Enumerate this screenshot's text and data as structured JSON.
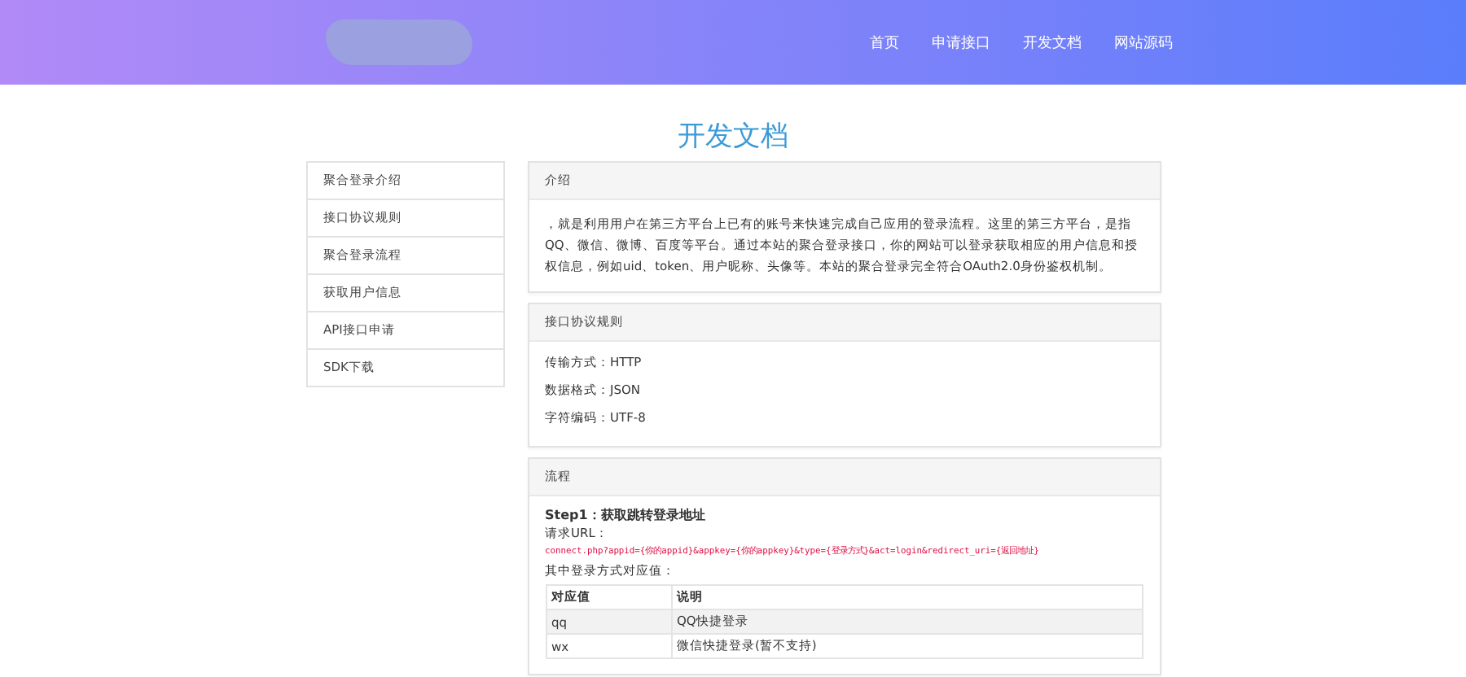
{
  "nav": [
    {
      "label": "首页"
    },
    {
      "label": "申请接口"
    },
    {
      "label": "开发文档"
    },
    {
      "label": "网站源码"
    }
  ],
  "page_title": "开发文档",
  "sidebar": {
    "items": [
      {
        "label": "聚合登录介绍"
      },
      {
        "label": "接口协议规则"
      },
      {
        "label": "聚合登录流程"
      },
      {
        "label": "获取用户信息"
      },
      {
        "label": "API接口申请"
      },
      {
        "label": "SDK下载"
      }
    ]
  },
  "intro": {
    "title": "介绍",
    "text": "，就是利用用户在第三方平台上已有的账号来快速完成自己应用的登录流程。这里的第三方平台，是指QQ、微信、微博、百度等平台。通过本站的聚合登录接口，你的网站可以登录获取相应的用户信息和授权信息，例如uid、token、用户昵称、头像等。本站的聚合登录完全符合OAuth2.0身份鉴权机制。"
  },
  "rules": {
    "title": "接口协议规则",
    "lines": [
      "传输方式：HTTP",
      "数据格式：JSON",
      "字符编码：UTF-8"
    ]
  },
  "flow": {
    "title": "流程",
    "step": "Step1：获取跳转登录地址",
    "url_label": "请求URL：",
    "url": "connect.php?appid={你的appid}&appkey={你的appkey}&type={登录方式}&act=login&redirect_uri={返回地址}",
    "types_label": "其中登录方式对应值：",
    "table": {
      "columns": [
        "对应值",
        "说明"
      ],
      "rows": [
        [
          "qq",
          "QQ快捷登录"
        ],
        [
          "wx",
          "微信快捷登录(暂不支持)"
        ]
      ]
    }
  }
}
